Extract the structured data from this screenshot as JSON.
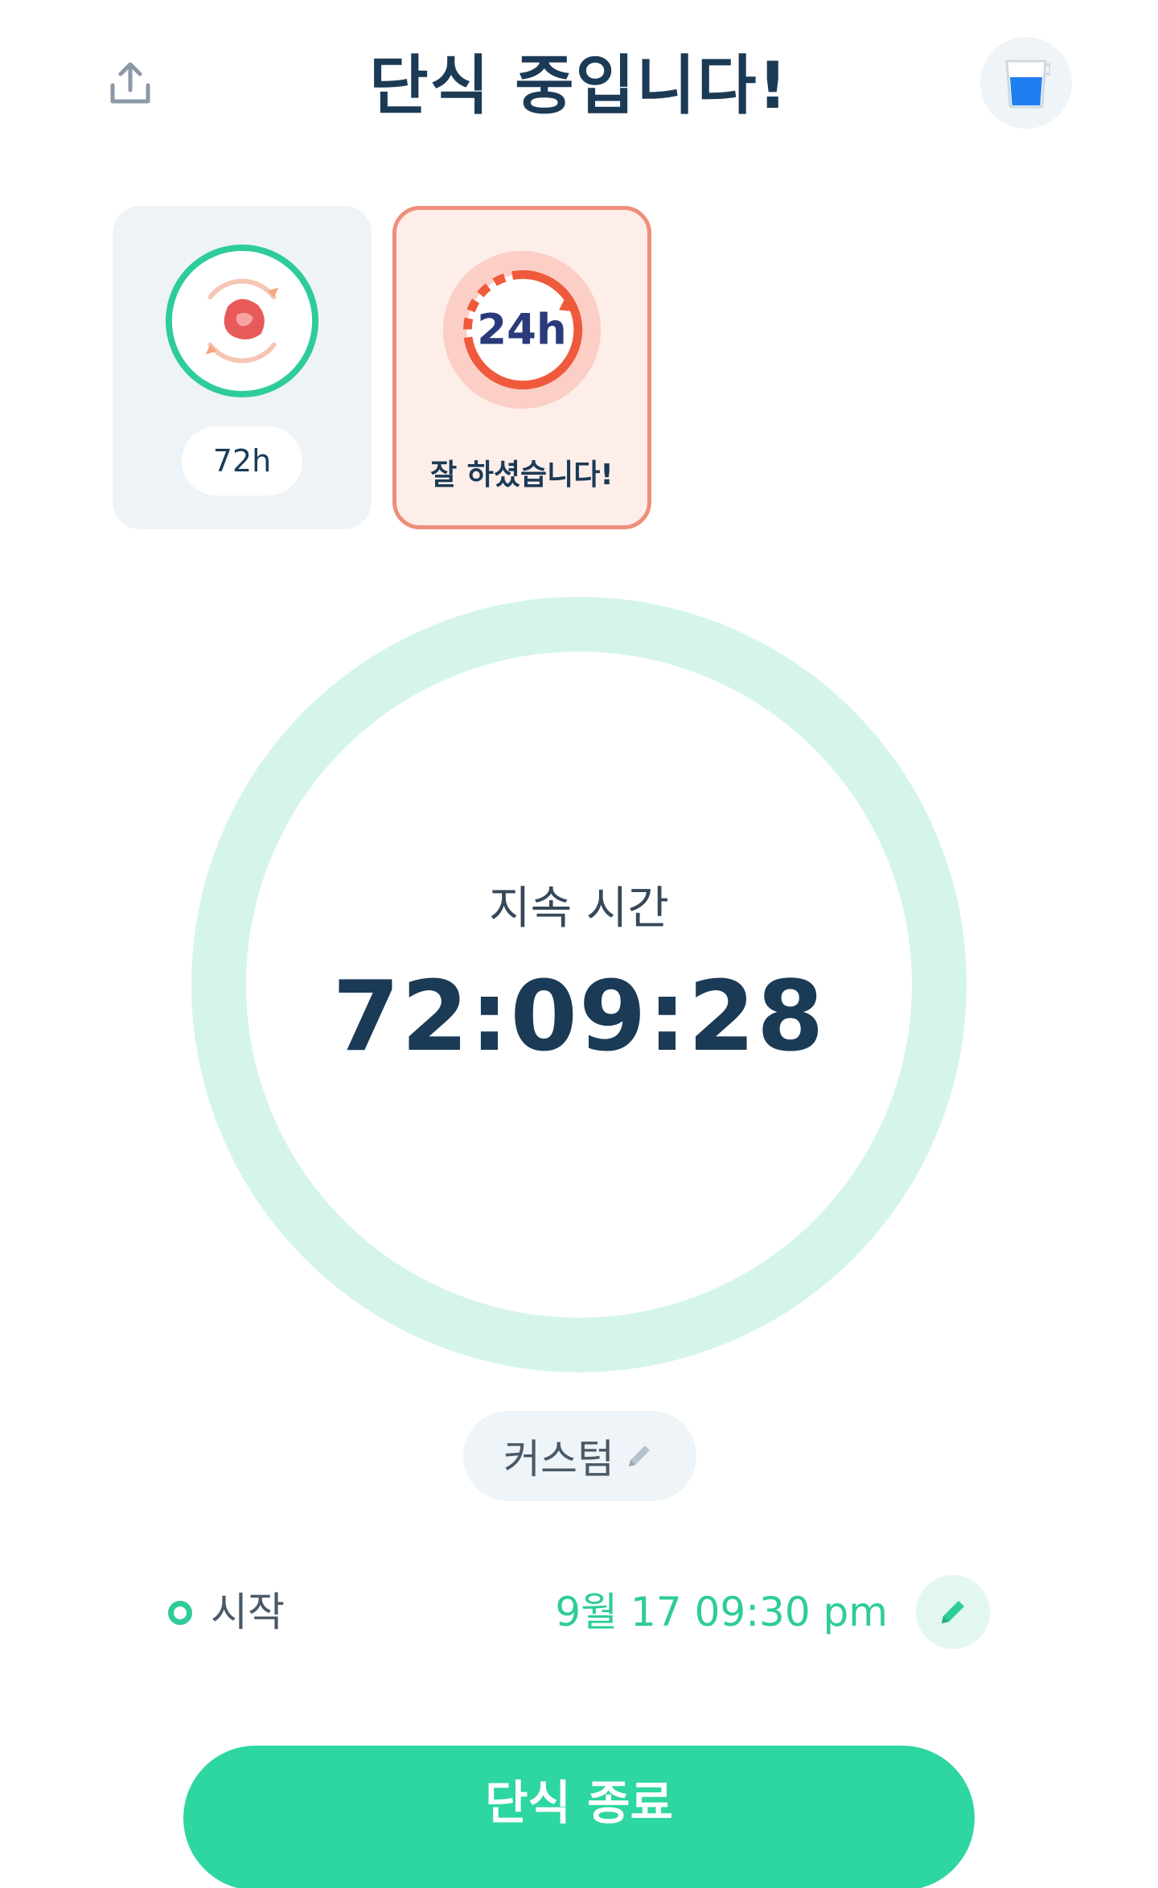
{
  "header": {
    "title": "단식 중입니다!",
    "share_icon": "share-icon",
    "water_icon": "water-glass-icon"
  },
  "badges": [
    {
      "label": "72h",
      "icon": "stomach-cycle-icon",
      "selected": false
    },
    {
      "label": "잘 하셨습니다!",
      "icon": "24h-clock-icon",
      "icon_text": "24h",
      "selected": true
    }
  ],
  "timer": {
    "label": "지속 시간",
    "elapsed": "72:09:28"
  },
  "plan": {
    "label": "커스텀",
    "icon": "pencil-icon"
  },
  "start": {
    "label": "시작",
    "value": "9월 17 09:30 pm",
    "icon": "pencil-icon"
  },
  "primary_action": {
    "label": "단식 종료"
  },
  "colors": {
    "accent": "#2ed6a1",
    "accent_text": "#2ecc9a",
    "ring": "#d5f5ea",
    "title": "#1b3a55",
    "badge_highlight": "#ef8e7d",
    "badge_highlight_bg": "#fdeeea",
    "card_bg": "#eef3f7"
  }
}
